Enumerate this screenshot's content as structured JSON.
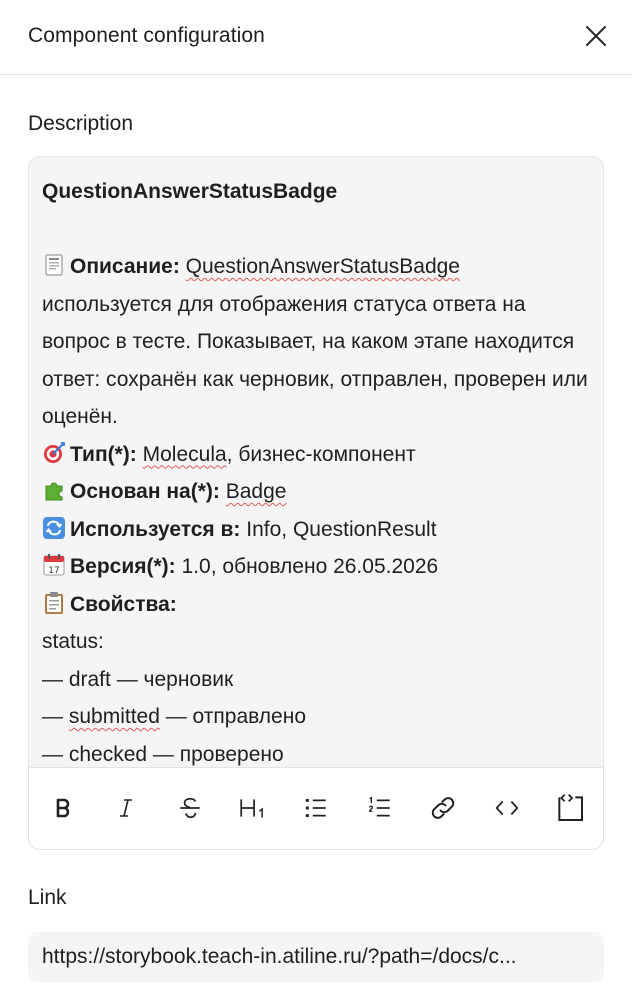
{
  "header": {
    "title": "Component configuration",
    "close_icon": "close-icon"
  },
  "description": {
    "label": "Description",
    "title": "QuestionAnswerStatusBadge",
    "desc_label": "Описание:",
    "desc_name": "QuestionAnswerStatusBadge",
    "desc_text": "используется для отображения статуса ответа на вопрос в тесте. Показывает, на каком этапе находится ответ: сохранён как черновик, отправлен, проверен или оценён.",
    "type_label": "Тип(*):",
    "type_value_a": "Molecula",
    "type_value_b": ", бизнес-компонент",
    "based_label": "Основан на(*):",
    "based_value": "Badge",
    "used_label": "Используется в:",
    "used_value": "Info, QuestionResult",
    "version_label": "Версия(*):",
    "version_value": "1.0, обновлено 26.05.2026",
    "props_label": "Свойства:",
    "props_status": "status:",
    "prop_draft": "— draft — черновик",
    "prop_submitted_a": "— ",
    "prop_submitted_b": "submitted",
    "prop_submitted_c": " — отправлено",
    "prop_checked": "— checked — проверено",
    "icons": [
      "document-icon",
      "target-icon",
      "puzzle-icon",
      "repeat-icon",
      "calendar-icon",
      "clipboard-icon"
    ]
  },
  "toolbar": {
    "buttons": [
      "bold-icon",
      "italic-icon",
      "strikethrough-icon",
      "heading1-icon",
      "bullet-list-icon",
      "ordered-list-icon",
      "link-icon",
      "code-icon",
      "code-block-icon"
    ]
  },
  "link": {
    "label": "Link",
    "value": "https://storybook.teach-in.atiline.ru/?path=/docs/c..."
  },
  "colors": {
    "text": "#1f1f1f",
    "editor_bg": "#f5f5f5",
    "border": "#e3e3e3",
    "spellcheck": "#e15b5b"
  }
}
